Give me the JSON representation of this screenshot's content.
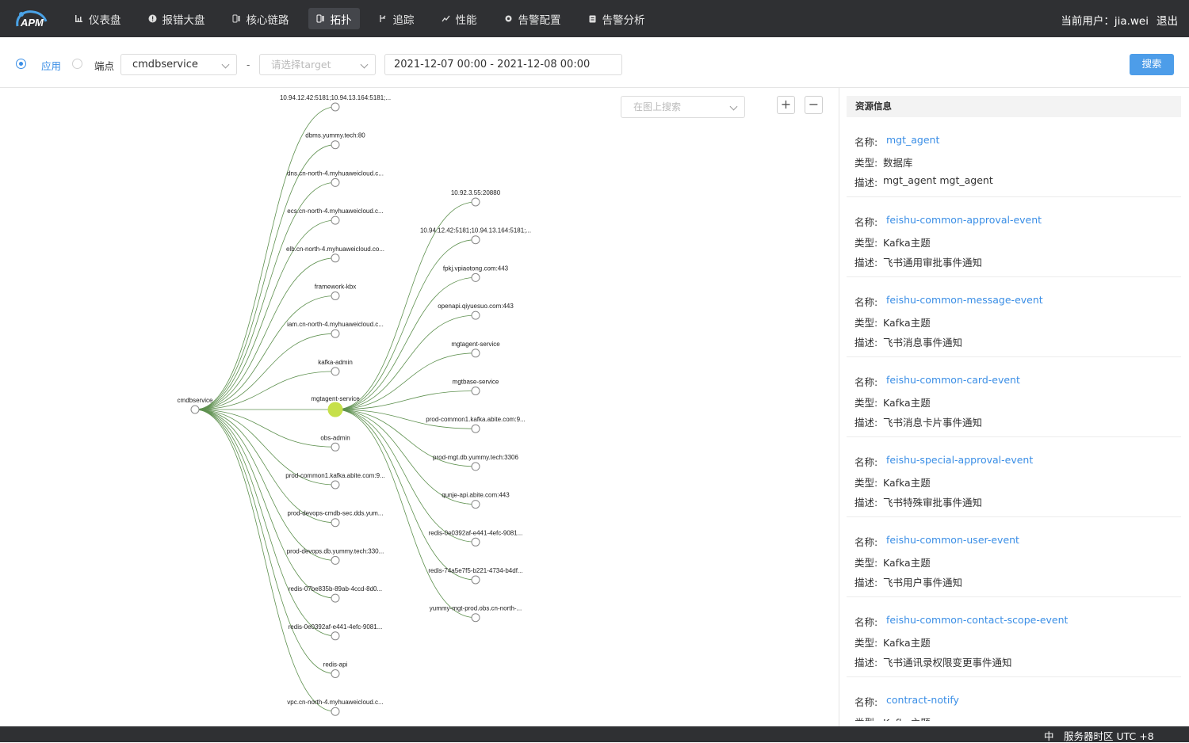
{
  "app": {
    "logo_text": "APM"
  },
  "nav": [
    {
      "label": "仪表盘",
      "icon": "bar-chart-icon",
      "active": false
    },
    {
      "label": "报错大盘",
      "icon": "alert-circle-icon",
      "active": false
    },
    {
      "label": "核心链路",
      "icon": "link-icon",
      "active": false
    },
    {
      "label": "拓扑",
      "icon": "topology-icon",
      "active": true
    },
    {
      "label": "追踪",
      "icon": "trace-icon",
      "active": false
    },
    {
      "label": "性能",
      "icon": "trend-icon",
      "active": false
    },
    {
      "label": "告警配置",
      "icon": "gear-icon",
      "active": false
    },
    {
      "label": "告警分析",
      "icon": "clipboard-icon",
      "active": false
    }
  ],
  "user": {
    "label": "当前用户：jia.wei",
    "logout": "退出"
  },
  "filter": {
    "mode_app": "应用",
    "mode_endpoint": "端点",
    "selected_mode": "应用",
    "service": "cmdbservice",
    "separator": "-",
    "target_placeholder": "请选择target",
    "time_range": "2021-12-07 00:00 - 2021-12-08 00:00",
    "search_button": "搜索"
  },
  "graph": {
    "search_placeholder": "在图上搜索",
    "zoom_in": "+",
    "zoom_out": "−",
    "root": "cmdbservice",
    "hub": "mgtagent-service",
    "root_children": [
      "10.94.12.42:5181;10.94.13.164:5181;...",
      "dbms.yummy.tech:80",
      "dns.cn-north-4.myhuaweicloud.c...",
      "ecs.cn-north-4.myhuaweicloud.c...",
      "elb.cn-north-4.myhuaweicloud.co...",
      "framework-kbx",
      "iam.cn-north-4.myhuaweicloud.c...",
      "kafka-admin",
      "mgtagent-service",
      "obs-admin",
      "prod-common1.kafka.abite.com:9...",
      "prod-devops-cmdb-sec.dds.yum...",
      "prod-devops.db.yummy.tech:330...",
      "redis-07be835b-89ab-4ccd-8d0...",
      "redis-0e0392af-e441-4efc-9081...",
      "redis-api",
      "vpc.cn-north-4.myhuaweicloud.c..."
    ],
    "hub_children": [
      "10.92.3.55:20880",
      "10.94.12.42:5181;10.94.13.164:5181;...",
      "fpkj.vpiaotong.com:443",
      "openapi.qiyuesuo.com:443",
      "mgtagent-service",
      "mgtbase-service",
      "prod-common1.kafka.abite.com:9...",
      "prod-mgt.db.yummy.tech:3306",
      "qunje-api.abite.com:443",
      "redis-0e0392af-e441-4efc-9081...",
      "redis-74a5e7f5-b221-4734-b4df...",
      "yummy-mgt-prod.obs.cn-north-..."
    ],
    "colors": {
      "edge": "#5f9150",
      "hub_fill": "#c6e04a",
      "node_stroke": "#888888"
    }
  },
  "panel": {
    "title": "资源信息",
    "key_name": "名称:",
    "key_type": "类型:",
    "key_desc": "描述:",
    "resources": [
      {
        "name": "mgt_agent",
        "type": "数据库",
        "desc": "mgt_agent mgt_agent"
      },
      {
        "name": "feishu-common-approval-event",
        "type": "Kafka主题",
        "desc": "飞书通用审批事件通知"
      },
      {
        "name": "feishu-common-message-event",
        "type": "Kafka主题",
        "desc": "飞书消息事件通知"
      },
      {
        "name": "feishu-common-card-event",
        "type": "Kafka主题",
        "desc": "飞书消息卡片事件通知"
      },
      {
        "name": "feishu-special-approval-event",
        "type": "Kafka主题",
        "desc": "飞书特殊审批事件通知"
      },
      {
        "name": "feishu-common-user-event",
        "type": "Kafka主题",
        "desc": "飞书用户事件通知"
      },
      {
        "name": "feishu-common-contact-scope-event",
        "type": "Kafka主题",
        "desc": "飞书通讯录权限变更事件通知"
      },
      {
        "name": "contract-notify",
        "type": "Kafka主题",
        "desc": ""
      }
    ]
  },
  "footer": {
    "lang": "中",
    "timezone": "服务器时区 UTC +8"
  }
}
